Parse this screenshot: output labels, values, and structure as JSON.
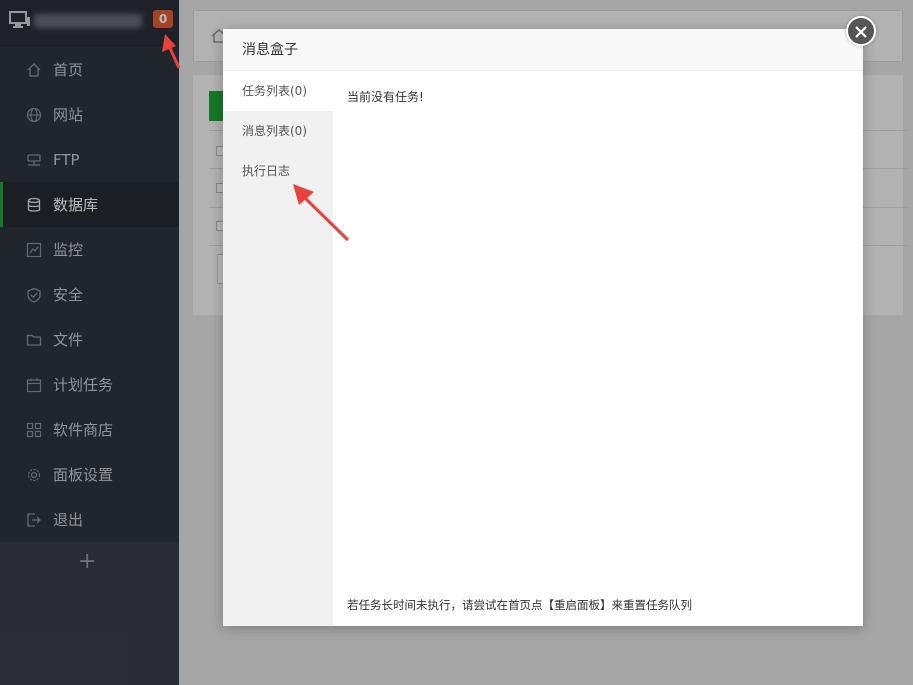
{
  "sidebar": {
    "badge_count": "0",
    "menu": [
      {
        "label": "首页",
        "icon": "home-icon"
      },
      {
        "label": "网站",
        "icon": "globe-icon"
      },
      {
        "label": "FTP",
        "icon": "ftp-icon"
      },
      {
        "label": "数据库",
        "icon": "database-icon",
        "active": true
      },
      {
        "label": "监控",
        "icon": "monitor-chart-icon"
      },
      {
        "label": "安全",
        "icon": "shield-icon"
      },
      {
        "label": "文件",
        "icon": "folder-icon"
      },
      {
        "label": "计划任务",
        "icon": "calendar-icon"
      },
      {
        "label": "软件商店",
        "icon": "grid-icon"
      },
      {
        "label": "面板设置",
        "icon": "gear-icon"
      },
      {
        "label": "退出",
        "icon": "logout-icon"
      }
    ],
    "add_label": "+"
  },
  "modal": {
    "title": "消息盒子",
    "tabs": [
      {
        "label": "任务列表(0)",
        "active": true
      },
      {
        "label": "消息列表(0)"
      },
      {
        "label": "执行日志"
      }
    ],
    "empty_text": "当前没有任务!",
    "footer_note": "若任务长时间未执行，请尝试在首页点【重启面板】来重置任务队列"
  },
  "colors": {
    "sidebar_bg": "#2f353d",
    "accent_green": "#20a53a",
    "badge_orange": "#e25f35",
    "annotation_red": "#e8423c"
  }
}
